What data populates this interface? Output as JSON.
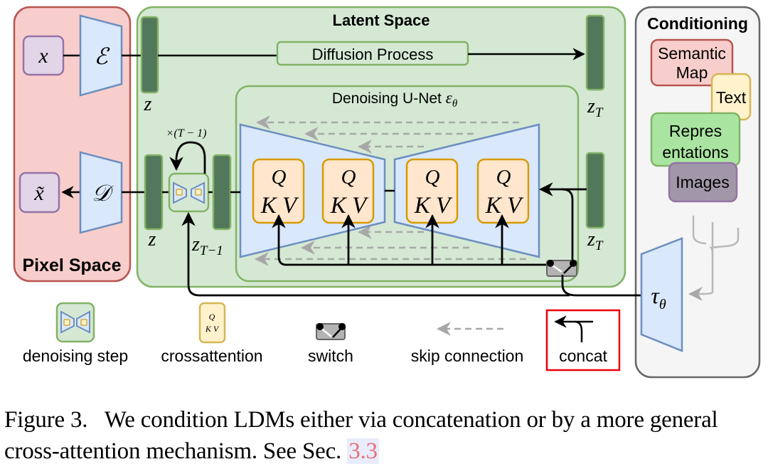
{
  "figure": {
    "panels": {
      "pixel_space": {
        "label": "Pixel Space"
      },
      "latent_space": {
        "label": "Latent Space"
      },
      "conditioning": {
        "label": "Conditioning"
      },
      "unet": {
        "label": "Denoising U-Net",
        "symbol": "ε",
        "subscript": "θ"
      }
    },
    "nodes": {
      "x": "x",
      "x_tilde": "x̃",
      "encoder": "ℰ",
      "decoder": "𝒟",
      "z_top": "z",
      "z_bottom": "z",
      "z_T_top": {
        "base": "z",
        "sub": "T"
      },
      "z_T_bottom": {
        "base": "z",
        "sub": "T"
      },
      "z_T_minus_1": {
        "base": "z",
        "sub": "T−1"
      },
      "repeat": "×(T − 1)",
      "diffusion_process": "Diffusion Process",
      "tau": {
        "base": "τ",
        "sub": "θ"
      },
      "attention_block": {
        "q": "Q",
        "kv": "K V"
      }
    },
    "conditioning_items": [
      {
        "label_lines": [
          "Semantic",
          "Map"
        ],
        "fill": "#f8cecc",
        "stroke": "#b85450"
      },
      {
        "label_lines": [
          "Text"
        ],
        "fill": "#fff2cc",
        "stroke": "#d6b656"
      },
      {
        "label_lines": [
          "Repres",
          "entations"
        ],
        "fill": "#a9e5a1",
        "stroke": "#82b366"
      },
      {
        "label_lines": [
          "Images"
        ],
        "fill": "#a197a8",
        "stroke": "#9673a6"
      }
    ],
    "legend": [
      {
        "key": "denoising_step",
        "label": "denoising step"
      },
      {
        "key": "crossattention",
        "label": "crossattention"
      },
      {
        "key": "switch",
        "label": "switch"
      },
      {
        "key": "skip_connection",
        "label": "skip connection"
      },
      {
        "key": "concat",
        "label": "concat",
        "highlighted": true,
        "highlight_color": "#e8000b"
      }
    ],
    "colors": {
      "pixel_fill": "#f8cecc",
      "pixel_stroke": "#b85450",
      "latent_fill": "#d5e8d4",
      "latent_stroke": "#82b366",
      "latent_bar": "#52775a",
      "blue_fill": "#dae8fc",
      "blue_stroke": "#6c8ebf",
      "purple_fill": "#e1d5e7",
      "purple_stroke": "#9673a6",
      "attn_fill": "#ffe6cc",
      "attn_stroke": "#d79b00",
      "cond_fill": "#f5f5f5",
      "cond_stroke": "#666666",
      "skip_gray": "#a8a8a8"
    }
  },
  "caption": {
    "prefix": "Figure 3.",
    "text": "We condition LDMs either via concatenation or by a more general cross-attention mechanism. See Sec.",
    "ref": "3.3"
  }
}
